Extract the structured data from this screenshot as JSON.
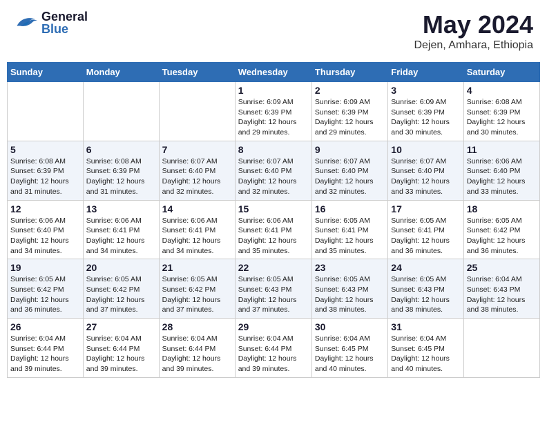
{
  "header": {
    "logo_general": "General",
    "logo_blue": "Blue",
    "month_title": "May 2024",
    "subtitle": "Dejen, Amhara, Ethiopia"
  },
  "days_of_week": [
    "Sunday",
    "Monday",
    "Tuesday",
    "Wednesday",
    "Thursday",
    "Friday",
    "Saturday"
  ],
  "weeks": [
    [
      {
        "day": "",
        "info": ""
      },
      {
        "day": "",
        "info": ""
      },
      {
        "day": "",
        "info": ""
      },
      {
        "day": "1",
        "info": "Sunrise: 6:09 AM\nSunset: 6:39 PM\nDaylight: 12 hours\nand 29 minutes."
      },
      {
        "day": "2",
        "info": "Sunrise: 6:09 AM\nSunset: 6:39 PM\nDaylight: 12 hours\nand 29 minutes."
      },
      {
        "day": "3",
        "info": "Sunrise: 6:09 AM\nSunset: 6:39 PM\nDaylight: 12 hours\nand 30 minutes."
      },
      {
        "day": "4",
        "info": "Sunrise: 6:08 AM\nSunset: 6:39 PM\nDaylight: 12 hours\nand 30 minutes."
      }
    ],
    [
      {
        "day": "5",
        "info": "Sunrise: 6:08 AM\nSunset: 6:39 PM\nDaylight: 12 hours\nand 31 minutes."
      },
      {
        "day": "6",
        "info": "Sunrise: 6:08 AM\nSunset: 6:39 PM\nDaylight: 12 hours\nand 31 minutes."
      },
      {
        "day": "7",
        "info": "Sunrise: 6:07 AM\nSunset: 6:40 PM\nDaylight: 12 hours\nand 32 minutes."
      },
      {
        "day": "8",
        "info": "Sunrise: 6:07 AM\nSunset: 6:40 PM\nDaylight: 12 hours\nand 32 minutes."
      },
      {
        "day": "9",
        "info": "Sunrise: 6:07 AM\nSunset: 6:40 PM\nDaylight: 12 hours\nand 32 minutes."
      },
      {
        "day": "10",
        "info": "Sunrise: 6:07 AM\nSunset: 6:40 PM\nDaylight: 12 hours\nand 33 minutes."
      },
      {
        "day": "11",
        "info": "Sunrise: 6:06 AM\nSunset: 6:40 PM\nDaylight: 12 hours\nand 33 minutes."
      }
    ],
    [
      {
        "day": "12",
        "info": "Sunrise: 6:06 AM\nSunset: 6:40 PM\nDaylight: 12 hours\nand 34 minutes."
      },
      {
        "day": "13",
        "info": "Sunrise: 6:06 AM\nSunset: 6:41 PM\nDaylight: 12 hours\nand 34 minutes."
      },
      {
        "day": "14",
        "info": "Sunrise: 6:06 AM\nSunset: 6:41 PM\nDaylight: 12 hours\nand 34 minutes."
      },
      {
        "day": "15",
        "info": "Sunrise: 6:06 AM\nSunset: 6:41 PM\nDaylight: 12 hours\nand 35 minutes."
      },
      {
        "day": "16",
        "info": "Sunrise: 6:05 AM\nSunset: 6:41 PM\nDaylight: 12 hours\nand 35 minutes."
      },
      {
        "day": "17",
        "info": "Sunrise: 6:05 AM\nSunset: 6:41 PM\nDaylight: 12 hours\nand 36 minutes."
      },
      {
        "day": "18",
        "info": "Sunrise: 6:05 AM\nSunset: 6:42 PM\nDaylight: 12 hours\nand 36 minutes."
      }
    ],
    [
      {
        "day": "19",
        "info": "Sunrise: 6:05 AM\nSunset: 6:42 PM\nDaylight: 12 hours\nand 36 minutes."
      },
      {
        "day": "20",
        "info": "Sunrise: 6:05 AM\nSunset: 6:42 PM\nDaylight: 12 hours\nand 37 minutes."
      },
      {
        "day": "21",
        "info": "Sunrise: 6:05 AM\nSunset: 6:42 PM\nDaylight: 12 hours\nand 37 minutes."
      },
      {
        "day": "22",
        "info": "Sunrise: 6:05 AM\nSunset: 6:43 PM\nDaylight: 12 hours\nand 37 minutes."
      },
      {
        "day": "23",
        "info": "Sunrise: 6:05 AM\nSunset: 6:43 PM\nDaylight: 12 hours\nand 38 minutes."
      },
      {
        "day": "24",
        "info": "Sunrise: 6:05 AM\nSunset: 6:43 PM\nDaylight: 12 hours\nand 38 minutes."
      },
      {
        "day": "25",
        "info": "Sunrise: 6:04 AM\nSunset: 6:43 PM\nDaylight: 12 hours\nand 38 minutes."
      }
    ],
    [
      {
        "day": "26",
        "info": "Sunrise: 6:04 AM\nSunset: 6:44 PM\nDaylight: 12 hours\nand 39 minutes."
      },
      {
        "day": "27",
        "info": "Sunrise: 6:04 AM\nSunset: 6:44 PM\nDaylight: 12 hours\nand 39 minutes."
      },
      {
        "day": "28",
        "info": "Sunrise: 6:04 AM\nSunset: 6:44 PM\nDaylight: 12 hours\nand 39 minutes."
      },
      {
        "day": "29",
        "info": "Sunrise: 6:04 AM\nSunset: 6:44 PM\nDaylight: 12 hours\nand 39 minutes."
      },
      {
        "day": "30",
        "info": "Sunrise: 6:04 AM\nSunset: 6:45 PM\nDaylight: 12 hours\nand 40 minutes."
      },
      {
        "day": "31",
        "info": "Sunrise: 6:04 AM\nSunset: 6:45 PM\nDaylight: 12 hours\nand 40 minutes."
      },
      {
        "day": "",
        "info": ""
      }
    ]
  ]
}
